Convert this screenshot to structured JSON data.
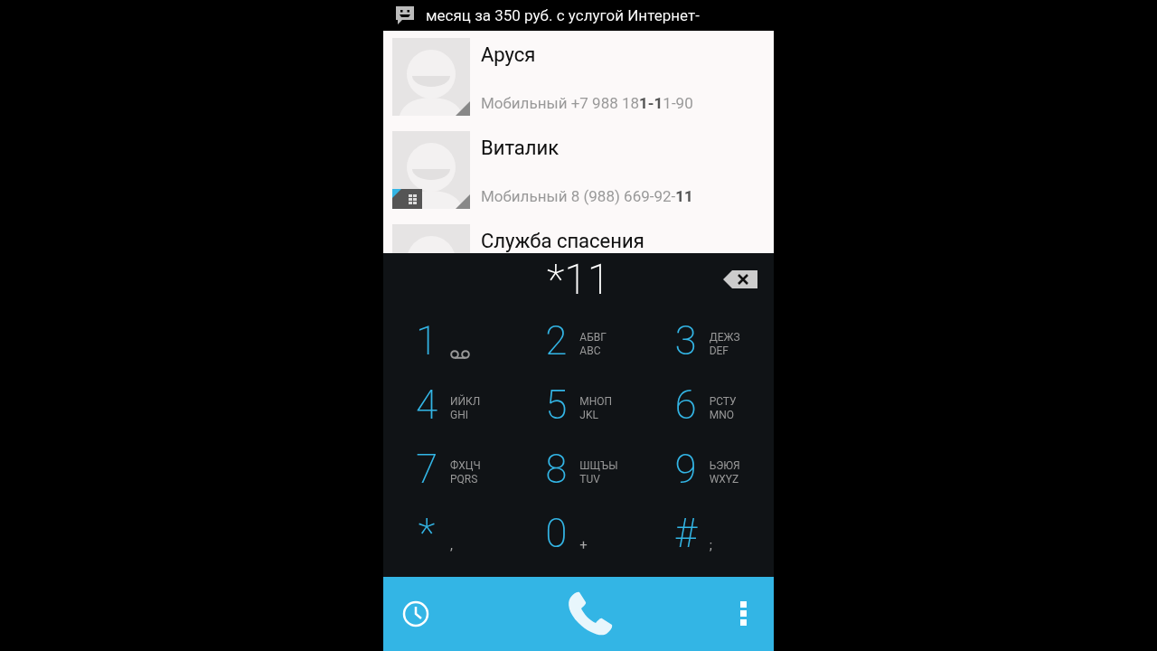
{
  "status_bar": {
    "ticker": "месяц за 350 руб. с услугой Интернет-"
  },
  "contacts": [
    {
      "name": "Аруся",
      "number": "Мобильный +7 988 18**1-1**1-90",
      "sim_badge": false
    },
    {
      "name": "Виталик",
      "number": "Мобильный 8 (988) 669-92-**11**",
      "sim_badge": true
    },
    {
      "name": "Служба спасения"
    }
  ],
  "dialpad": {
    "digits": "*11",
    "keys": [
      {
        "digit": "1",
        "kind": "voicemail"
      },
      {
        "digit": "2",
        "kind": "letters",
        "letters": [
          "АБВГ",
          "ABC"
        ]
      },
      {
        "digit": "3",
        "kind": "letters",
        "letters": [
          "ДЕЖЗ",
          "DEF"
        ]
      },
      {
        "digit": "4",
        "kind": "letters",
        "letters": [
          "ИЙКЛ",
          "GHI"
        ]
      },
      {
        "digit": "5",
        "kind": "letters",
        "letters": [
          "МНОП",
          "JKL"
        ]
      },
      {
        "digit": "6",
        "kind": "letters",
        "letters": [
          "РСТУ",
          "MNO"
        ]
      },
      {
        "digit": "7",
        "kind": "letters",
        "letters": [
          "ФХЦЧ",
          "PQRS"
        ]
      },
      {
        "digit": "8",
        "kind": "letters",
        "letters": [
          "ШЩЪЫ",
          "TUV"
        ]
      },
      {
        "digit": "9",
        "kind": "letters",
        "letters": [
          "ЬЭЮЯ",
          "WXYZ"
        ]
      },
      {
        "digit": "*",
        "kind": "symbol",
        "symbol": ","
      },
      {
        "digit": "0",
        "kind": "symbol",
        "symbol": "+"
      },
      {
        "digit": "#",
        "kind": "symbol",
        "symbol": ";"
      }
    ]
  }
}
